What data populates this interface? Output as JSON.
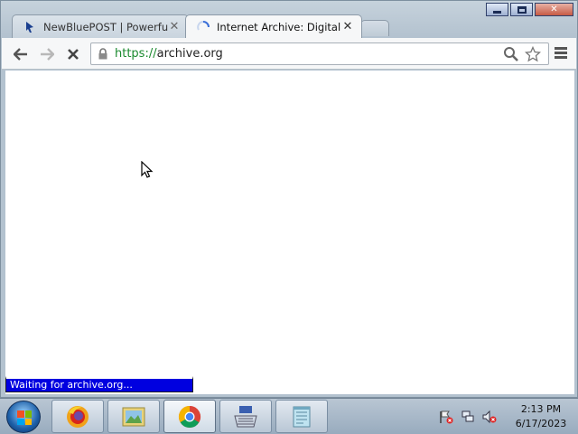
{
  "browser": {
    "tabs": [
      {
        "title": "NewBluePOST | Powerful",
        "active": false,
        "favicon": "newblue-logo-icon"
      },
      {
        "title": "Internet Archive: Digital Li",
        "active": true,
        "favicon": "loading-spinner-icon"
      }
    ],
    "address_bar": {
      "scheme": "https://",
      "host": "archive.org"
    },
    "status_text": "Waiting for archive.org...",
    "colors": {
      "secure_scheme": "#1a8a2e",
      "status_bg": "#0000e0"
    }
  },
  "window_controls": [
    "minimize-icon",
    "maximize-icon",
    "close-icon"
  ],
  "taskbar": {
    "apps": [
      {
        "name": "firefox-icon",
        "active": false
      },
      {
        "name": "photo-viewer-icon",
        "active": false
      },
      {
        "name": "chrome-icon",
        "active": true
      },
      {
        "name": "keyboard-app-icon",
        "active": false
      },
      {
        "name": "notepad-icon",
        "active": false
      }
    ],
    "tray_icons": [
      "action-center-flag-icon",
      "network-icon",
      "volume-muted-icon"
    ],
    "clock": {
      "time": "2:13 PM",
      "date": "6/17/2023"
    }
  }
}
